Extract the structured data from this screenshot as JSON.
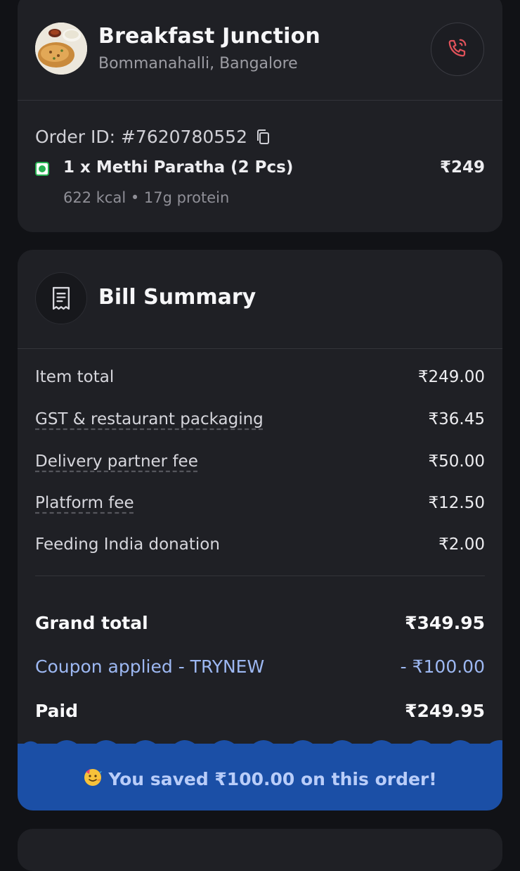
{
  "restaurant": {
    "name": "Breakfast Junction",
    "location": "Bommanahalli, Bangalore"
  },
  "order": {
    "id_text": "Order ID: #7620780552",
    "item_name": "1 x Methi Paratha (2 Pcs)",
    "item_price": "₹249",
    "nutrition": "622 kcal • 17g protein"
  },
  "bill": {
    "title": "Bill Summary",
    "rows": [
      {
        "label": "Item total",
        "value": "₹249.00"
      },
      {
        "label": "GST & restaurant packaging",
        "value": "₹36.45"
      },
      {
        "label": "Delivery partner fee",
        "value": "₹50.00"
      },
      {
        "label": "Platform fee",
        "value": "₹12.50"
      },
      {
        "label": "Feeding India donation",
        "value": "₹2.00"
      }
    ],
    "grand_total_label": "Grand total",
    "grand_total_value": "₹349.95",
    "coupon_label": "Coupon applied - TRYNEW",
    "coupon_value": "- ₹100.00",
    "paid_label": "Paid",
    "paid_value": "₹249.95",
    "savings_text": "You saved ₹100.00 on this order!"
  },
  "colors": {
    "background": "#111216",
    "card": "#1f2025",
    "accent_blue": "#1b4fa6",
    "coupon_text": "#9db8f2",
    "veg_green": "#27b052",
    "call_icon": "#e0525a"
  },
  "icons": {
    "call": "phone-call-icon",
    "copy": "copy-icon",
    "veg": "veg-indicator-icon",
    "bill": "receipt-icon",
    "savings": "party-emoji-icon"
  }
}
